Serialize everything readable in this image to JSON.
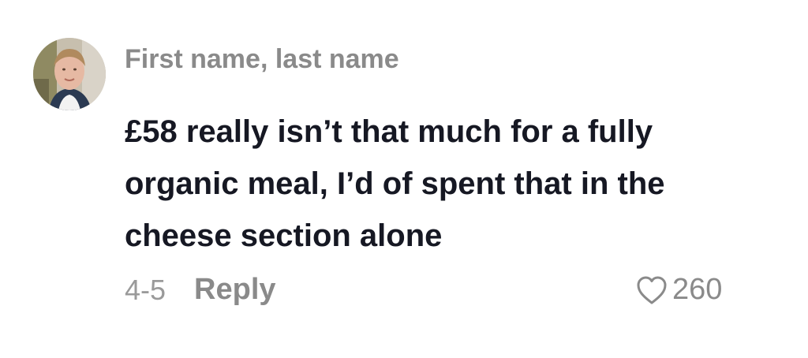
{
  "comment": {
    "author": "First name, last name",
    "text_lines": [
      "£58 really isn’t that much for a fully",
      "organic meal, I’d of spent that in the",
      "cheese section alone"
    ],
    "date": "4-5",
    "reply_label": "Reply",
    "like_count": "260",
    "avatar_icon": "user-avatar-photo",
    "like_icon": "heart-outline-icon"
  },
  "colors": {
    "text": "#161823",
    "muted": "#8a8a8a",
    "background": "#ffffff"
  }
}
